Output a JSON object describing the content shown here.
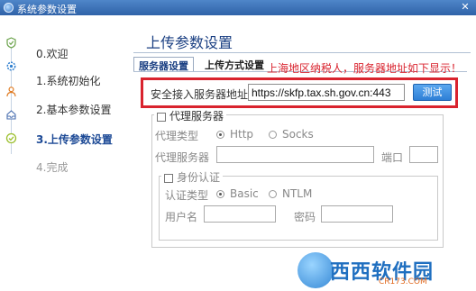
{
  "window": {
    "title": "系统参数设置",
    "close_glyph": "✕"
  },
  "steps": [
    {
      "label": "0.欢迎",
      "icon": "shield-check-icon",
      "state": "done"
    },
    {
      "label": "1.系统初始化",
      "icon": "gear-icon",
      "state": "done"
    },
    {
      "label": "2.基本参数设置",
      "icon": "user-icon",
      "state": "done"
    },
    {
      "label": "3.上传参数设置",
      "icon": "check-circle-icon",
      "state": "active"
    },
    {
      "label": "4.完成",
      "icon": "none",
      "state": "pending"
    }
  ],
  "main": {
    "title": "上传参数设置",
    "tabs": [
      {
        "label": "服务器设置",
        "active": true
      },
      {
        "label": "上传方式设置",
        "active": false
      }
    ],
    "notice": "上海地区纳税人，服务器地址如下显示！",
    "server": {
      "label": "安全接入服务器地址:",
      "value": "https://skfp.tax.sh.gov.cn:443",
      "test_button": "测试"
    },
    "proxy": {
      "legend": "代理服务器",
      "type_label": "代理类型",
      "types": [
        {
          "label": "Http",
          "selected": true
        },
        {
          "label": "Socks",
          "selected": false
        }
      ],
      "server_label": "代理服务器",
      "server_value": "",
      "port_label": "端口",
      "port_value": "",
      "auth": {
        "legend": "身份认证",
        "type_label": "认证类型",
        "types": [
          {
            "label": "Basic",
            "selected": true
          },
          {
            "label": "NTLM",
            "selected": false
          }
        ],
        "username_label": "用户名",
        "username_value": "",
        "password_label": "密码",
        "password_value": ""
      }
    }
  },
  "watermark": {
    "text": "西西软件园",
    "sub": "CR173.COM"
  },
  "colors": {
    "title_bar": "#3a6fb8",
    "accent": "#1a3f82",
    "alert_red": "#d9232e",
    "button_blue": "#2e7fd6"
  }
}
